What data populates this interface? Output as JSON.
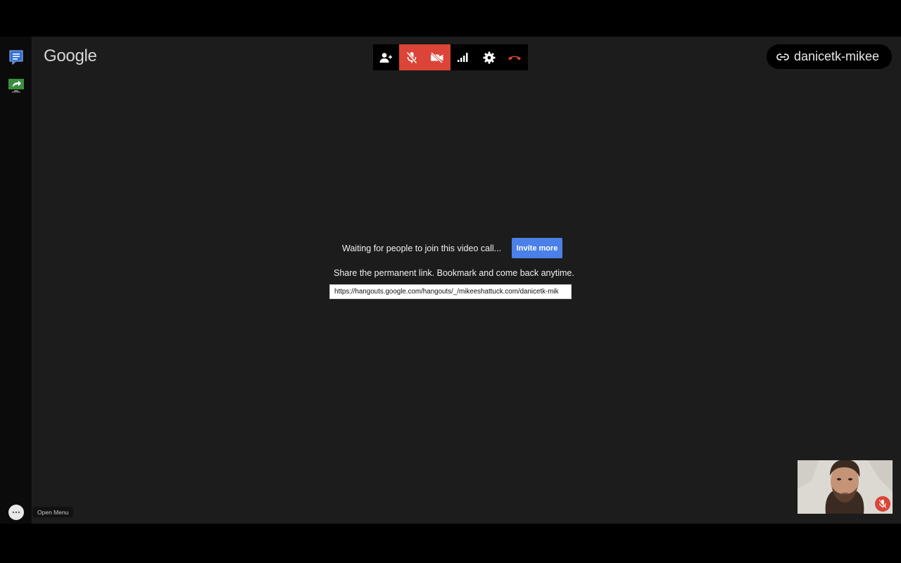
{
  "app": {
    "logo_text": "Google",
    "room_name": "danicetk-mikee"
  },
  "toolbar": {
    "buttons": [
      {
        "name": "add-people",
        "icon": "person-add-icon",
        "state": "normal"
      },
      {
        "name": "microphone",
        "icon": "mic-off-icon",
        "state": "muted"
      },
      {
        "name": "camera",
        "icon": "videocam-off-icon",
        "state": "off"
      },
      {
        "name": "bandwidth",
        "icon": "signal-bars-icon",
        "state": "normal"
      },
      {
        "name": "settings",
        "icon": "gear-icon",
        "state": "normal"
      },
      {
        "name": "hang-up",
        "icon": "hang-up-icon",
        "state": "normal"
      }
    ]
  },
  "call": {
    "waiting_text": "Waiting for people to join this video call...",
    "invite_label": "Invite more",
    "share_text": "Share the permanent link. Bookmark and come back anytime.",
    "link_value": "https://hangouts.google.com/hangouts/_/mikeeshattuck.com/danicetk-mik"
  },
  "footer": {
    "menu_tooltip": "Open Menu"
  },
  "colors": {
    "accent_blue": "#4a80e8",
    "alert_red": "#db4437",
    "background": "#1c1c1c"
  }
}
